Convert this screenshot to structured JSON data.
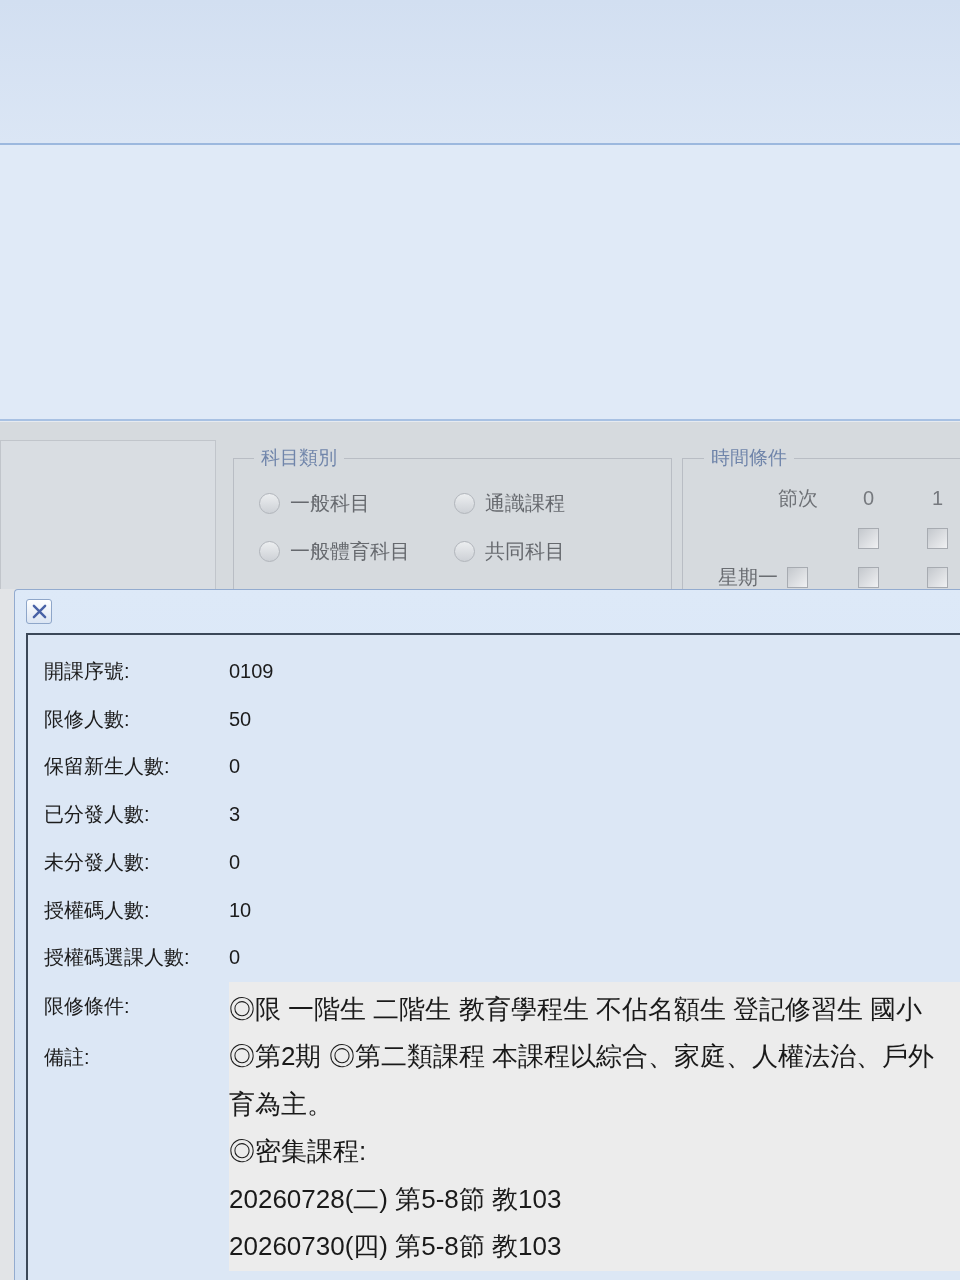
{
  "search_panel": {
    "subject_category": {
      "legend": "科目類別",
      "options": [
        {
          "label": "一般科目",
          "selected": false
        },
        {
          "label": "通識課程",
          "selected": false
        },
        {
          "label": "一般體育科目",
          "selected": false
        },
        {
          "label": "共同科目",
          "selected": false
        }
      ]
    },
    "time_condition": {
      "legend": "時間條件",
      "period_header": "節次",
      "periods": [
        {
          "label": "0",
          "checked": false
        },
        {
          "label": "1",
          "checked": false
        }
      ],
      "days": [
        {
          "label": "星期一",
          "checked": false,
          "slots": [
            {
              "checked": false
            },
            {
              "checked": false
            }
          ]
        }
      ]
    }
  },
  "dialog": {
    "fields": [
      {
        "label": "開課序號:",
        "value": "0109"
      },
      {
        "label": "限修人數:",
        "value": "50"
      },
      {
        "label": "保留新生人數:",
        "value": "0"
      },
      {
        "label": "已分發人數:",
        "value": "3"
      },
      {
        "label": "未分發人數:",
        "value": "0"
      },
      {
        "label": "授權碼人數:",
        "value": "10"
      },
      {
        "label": "授權碼選課人數:",
        "value": "0"
      }
    ],
    "notes": [
      {
        "label": "限修條件:",
        "lines": [
          "◎限 一階生 二階生 教育學程生 不佔名額生 登記修習生 國小"
        ]
      },
      {
        "label": "備註:",
        "lines": [
          "◎第2期 ◎第二類課程 本課程以綜合、家庭、人權法治、戶外",
          "育為主。",
          "◎密集課程:",
          "20260728(二) 第5-8節 教103",
          "20260730(四) 第5-8節 教103"
        ]
      }
    ]
  }
}
